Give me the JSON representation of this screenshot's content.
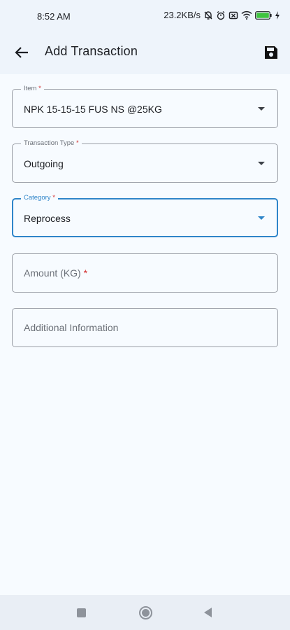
{
  "status_bar": {
    "time": "8:52 AM",
    "network_speed": "23.2KB/s",
    "battery_level": "96"
  },
  "app_bar": {
    "title": "Add Transaction",
    "back_icon": "arrow-back-icon",
    "save_icon": "save-icon"
  },
  "form": {
    "item": {
      "label": "Item",
      "required": "*",
      "value": "NPK 15-15-15 FUS NS @25KG"
    },
    "transaction_type": {
      "label": "Transaction Type",
      "required": "*",
      "value": "Outgoing"
    },
    "category": {
      "label": "Category",
      "required": "*",
      "value": "Reprocess"
    },
    "amount": {
      "placeholder": "Amount (KG)",
      "required": "*"
    },
    "additional_info": {
      "placeholder": "Additional Information"
    }
  },
  "colors": {
    "accent": "#2f85c9",
    "required": "#d32f2f",
    "battery": "#3fc43f"
  }
}
